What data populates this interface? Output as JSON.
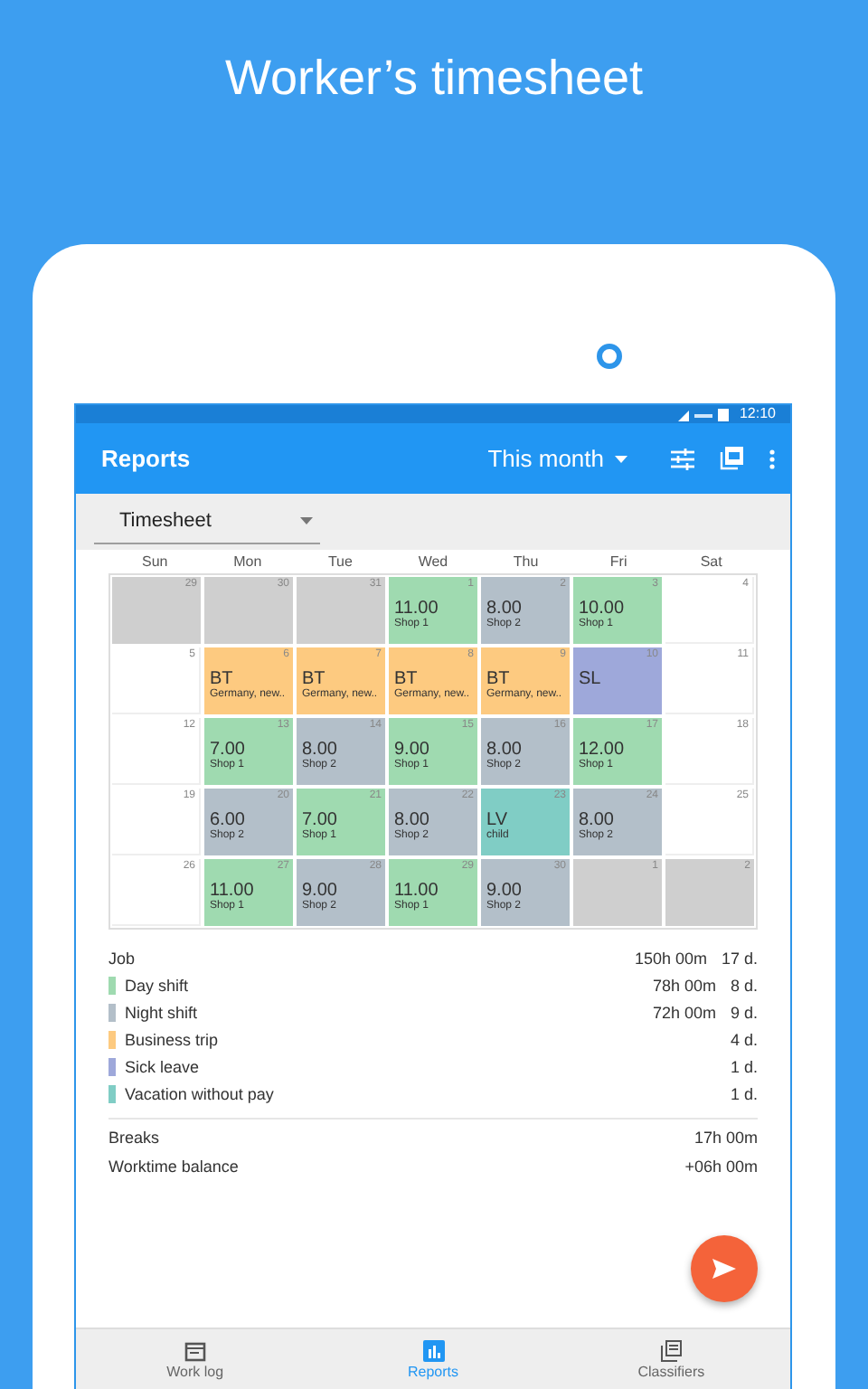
{
  "headline": "Worker’s timesheet",
  "status_bar": {
    "time": "12:10"
  },
  "app_bar": {
    "title": "Reports",
    "period": "This month"
  },
  "report_selector": {
    "value": "Timesheet"
  },
  "calendar": {
    "weekdays": [
      "Sun",
      "Mon",
      "Tue",
      "Wed",
      "Thu",
      "Fri",
      "Sat"
    ],
    "weeks": [
      [
        {
          "day": "29",
          "kind": "outside"
        },
        {
          "day": "30",
          "kind": "outside"
        },
        {
          "day": "31",
          "kind": "outside"
        },
        {
          "day": "1",
          "kind": "entry",
          "value": "11.00",
          "note": "Shop 1",
          "color": "#9fdab0"
        },
        {
          "day": "2",
          "kind": "entry",
          "value": "8.00",
          "note": "Shop 2",
          "color": "#b3bfc9"
        },
        {
          "day": "3",
          "kind": "entry",
          "value": "10.00",
          "note": "Shop 1",
          "color": "#9fdab0"
        },
        {
          "day": "4",
          "kind": "empty"
        }
      ],
      [
        {
          "day": "5",
          "kind": "empty"
        },
        {
          "day": "6",
          "kind": "entry",
          "value": "BT",
          "note": "Germany, new..",
          "color": "#fdca80"
        },
        {
          "day": "7",
          "kind": "entry",
          "value": "BT",
          "note": "Germany, new..",
          "color": "#fdca80"
        },
        {
          "day": "8",
          "kind": "entry",
          "value": "BT",
          "note": "Germany, new..",
          "color": "#fdca80"
        },
        {
          "day": "9",
          "kind": "entry",
          "value": "BT",
          "note": "Germany, new..",
          "color": "#fdca80"
        },
        {
          "day": "10",
          "kind": "entry",
          "value": "SL",
          "color": "#9ea8da"
        },
        {
          "day": "11",
          "kind": "empty"
        }
      ],
      [
        {
          "day": "12",
          "kind": "empty"
        },
        {
          "day": "13",
          "kind": "entry",
          "value": "7.00",
          "note": "Shop 1",
          "color": "#9fdab0"
        },
        {
          "day": "14",
          "kind": "entry",
          "value": "8.00",
          "note": "Shop 2",
          "color": "#b3bfc9"
        },
        {
          "day": "15",
          "kind": "entry",
          "value": "9.00",
          "note": "Shop 1",
          "color": "#9fdab0"
        },
        {
          "day": "16",
          "kind": "entry",
          "value": "8.00",
          "note": "Shop 2",
          "color": "#b3bfc9"
        },
        {
          "day": "17",
          "kind": "entry",
          "value": "12.00",
          "note": "Shop 1",
          "color": "#9fdab0"
        },
        {
          "day": "18",
          "kind": "empty"
        }
      ],
      [
        {
          "day": "19",
          "kind": "empty"
        },
        {
          "day": "20",
          "kind": "entry",
          "value": "6.00",
          "note": "Shop 2",
          "color": "#b3bfc9"
        },
        {
          "day": "21",
          "kind": "entry",
          "value": "7.00",
          "note": "Shop 1",
          "color": "#9fdab0"
        },
        {
          "day": "22",
          "kind": "entry",
          "value": "8.00",
          "note": "Shop 2",
          "color": "#b3bfc9"
        },
        {
          "day": "23",
          "kind": "entry",
          "value": "LV",
          "note": "child",
          "color": "#80cdc5"
        },
        {
          "day": "24",
          "kind": "entry",
          "value": "8.00",
          "note": "Shop 2",
          "color": "#b3bfc9"
        },
        {
          "day": "25",
          "kind": "empty"
        }
      ],
      [
        {
          "day": "26",
          "kind": "empty"
        },
        {
          "day": "27",
          "kind": "entry",
          "value": "11.00",
          "note": "Shop 1",
          "color": "#9fdab0"
        },
        {
          "day": "28",
          "kind": "entry",
          "value": "9.00",
          "note": "Shop 2",
          "color": "#b3bfc9"
        },
        {
          "day": "29",
          "kind": "entry",
          "value": "11.00",
          "note": "Shop 1",
          "color": "#9fdab0"
        },
        {
          "day": "30",
          "kind": "entry",
          "value": "9.00",
          "note": "Shop 2",
          "color": "#b3bfc9"
        },
        {
          "day": "1",
          "kind": "outside"
        },
        {
          "day": "2",
          "kind": "outside"
        }
      ]
    ]
  },
  "summary": {
    "job": {
      "label": "Job",
      "hours": "150h 00m",
      "days": "17 d."
    },
    "items": [
      {
        "label": "Day shift",
        "hours": "78h 00m",
        "days": "8 d.",
        "color": "#9fdab0"
      },
      {
        "label": "Night shift",
        "hours": "72h 00m",
        "days": "9 d.",
        "color": "#b3bfc9"
      },
      {
        "label": "Business trip",
        "days": "4 d.",
        "color": "#fdca80"
      },
      {
        "label": "Sick leave",
        "days": "1 d.",
        "color": "#9ea8da"
      },
      {
        "label": "Vacation without pay",
        "days": "1 d.",
        "color": "#80cdc5"
      }
    ],
    "totals": [
      {
        "label": "Breaks",
        "value": "17h 00m"
      },
      {
        "label": "Worktime balance",
        "value": "+06h 00m"
      }
    ]
  },
  "bottom_nav": [
    {
      "label": "Work log",
      "kind": "calendar",
      "selected": false
    },
    {
      "label": "Reports",
      "kind": "chart",
      "selected": true
    },
    {
      "label": "Classifiers",
      "kind": "stack",
      "selected": false
    }
  ]
}
